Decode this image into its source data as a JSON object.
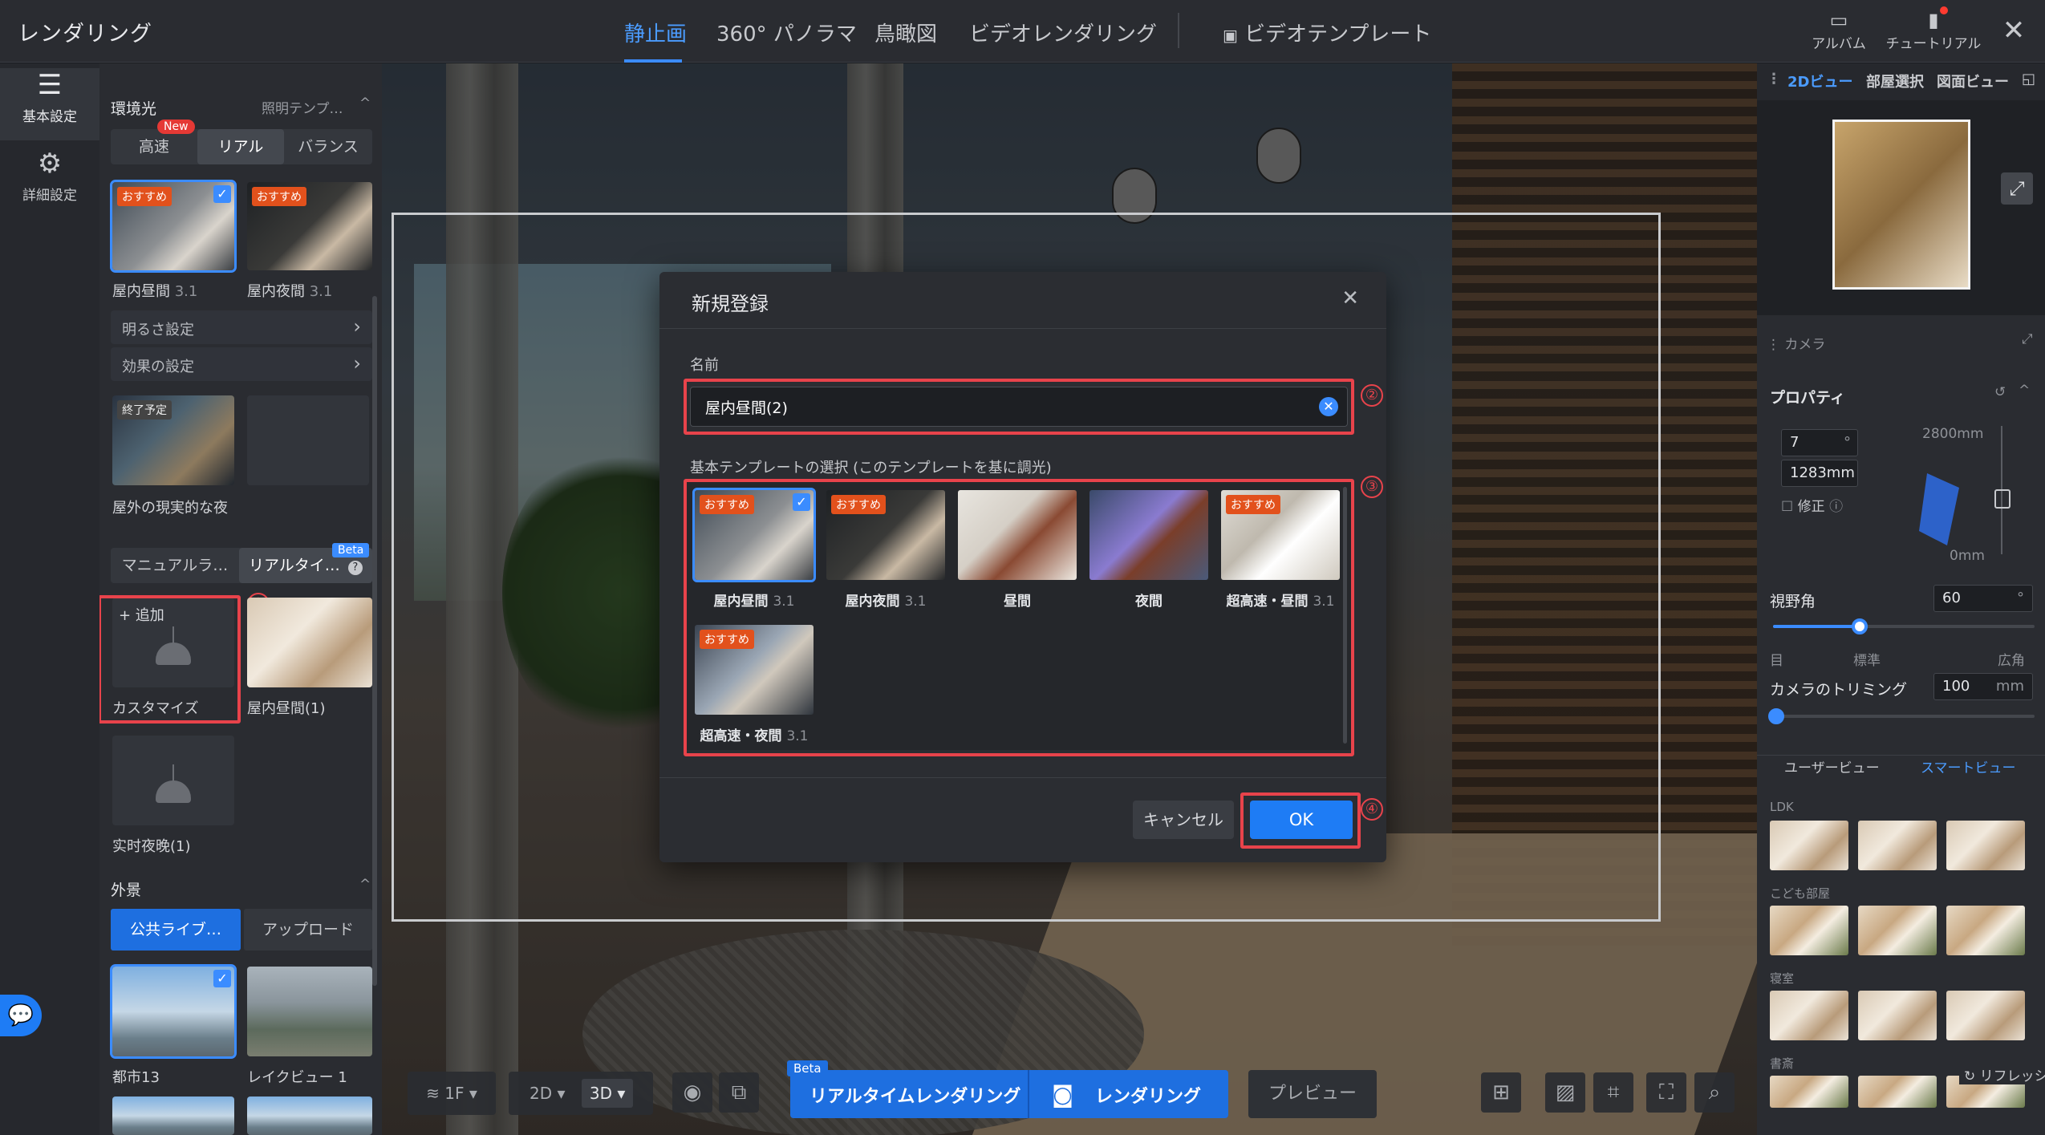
{
  "app": {
    "title": "レンダリング"
  },
  "nav": {
    "tabs": [
      "静止画",
      "360° パノラマ",
      "鳥瞰図",
      "ビデオレンダリング"
    ],
    "video_template": "ビデオテンプレート",
    "album": "アルバム",
    "tutorial": "チュートリアル"
  },
  "rail": {
    "basic": "基本設定",
    "detail": "詳細設定"
  },
  "left": {
    "env_light": "環境光",
    "lighting_template": "照明テンプ…",
    "modes": [
      "高速",
      "リアル",
      "バランス"
    ],
    "new_badge": "New",
    "presets": [
      {
        "tag": "おすすめ",
        "name": "屋内昼間",
        "ver": "3.1",
        "selected": true
      },
      {
        "tag": "おすすめ",
        "name": "屋内夜間",
        "ver": "3.1",
        "selected": false
      }
    ],
    "brightness": "明るさ設定",
    "effects": "効果の設定",
    "outdoor": {
      "tag": "終了予定",
      "name": "屋外の現実的な夜"
    },
    "render_modes": [
      "マニュアルラ…",
      "リアルタイ…"
    ],
    "beta": "Beta",
    "help": "?",
    "add": "+ 追加",
    "customize": "カスタマイズ",
    "custom_items": [
      "屋内昼間(1)",
      "实时夜晚(1)"
    ],
    "bg_section": "外景",
    "bg_tabs": [
      "公共ライブ…",
      "アップロード"
    ],
    "bg_items": [
      "都市13",
      "レイクビュー 1"
    ]
  },
  "markers": [
    "①",
    "②",
    "③",
    "④"
  ],
  "modal": {
    "title": "新規登録",
    "name_label": "名前",
    "name_value": "屋内昼間(2)",
    "template_label": "基本テンプレートの選択 (このテンプレートを基に調光)",
    "templates": [
      {
        "tag": "おすすめ",
        "name": "屋内昼間",
        "ver": "3.1",
        "selected": true
      },
      {
        "tag": "おすすめ",
        "name": "屋内夜間",
        "ver": "3.1",
        "selected": false
      },
      {
        "tag": "",
        "name": "昼間",
        "ver": "",
        "selected": false
      },
      {
        "tag": "",
        "name": "夜間",
        "ver": "",
        "selected": false
      },
      {
        "tag": "おすすめ",
        "name": "超高速・昼間",
        "ver": "3.1",
        "selected": false
      },
      {
        "tag": "おすすめ",
        "name": "超高速・夜間",
        "ver": "3.1",
        "selected": false
      }
    ],
    "cancel": "キャンセル",
    "ok": "OK"
  },
  "viewport": {
    "floor": "1F",
    "view2d": "2D",
    "view3d": "3D",
    "realtime_render": "リアルタイムレンダリング",
    "render": "レンダリング",
    "preview": "プレビュー",
    "beta": "Beta"
  },
  "right": {
    "tabs": [
      "2Dビュー",
      "部屋選択",
      "図面ビュー"
    ],
    "camera": "カメラ",
    "properties": "プロパティ",
    "angle_value": "7",
    "angle_unit": "°",
    "height_value": "1283mm",
    "correction": "修正",
    "top_mm": "2800mm",
    "bottom_mm": "0mm",
    "fov_label": "視野角",
    "fov_value": "60",
    "fov_unit": "°",
    "fov_ticks": [
      "目",
      "標準",
      "広角"
    ],
    "fov_fraction": 0.33,
    "trim_label": "カメラのトリミング",
    "trim_value": "100",
    "trim_unit": "mm",
    "trim_fraction": 0.0,
    "view_tabs": [
      "ユーザービュー",
      "スマートビュー"
    ],
    "rooms": [
      "LDK",
      "こども部屋",
      "寝室",
      "書斎"
    ],
    "refresh": "リフレッシ"
  }
}
